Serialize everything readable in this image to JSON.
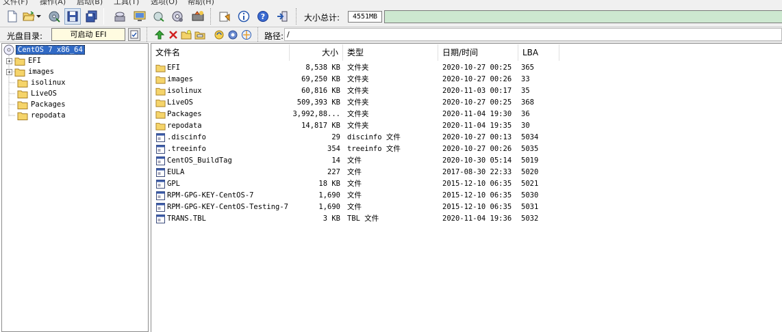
{
  "menubar": {
    "items": [
      "文件(F)",
      "操作(A)",
      "启动(B)",
      "工具(T)",
      "选项(O)",
      "帮助(H)"
    ]
  },
  "toolbar": {
    "buttons": [
      "new-icon",
      "open-icon",
      "dropdown-icon",
      "extract-icon",
      "save-icon",
      "saveas-icon",
      "burn-icon",
      "mount-icon",
      "compress-icon",
      "properties-icon",
      "virtual-drive-icon",
      "settings-icon",
      "info-icon",
      "help-icon",
      "exit-icon"
    ],
    "size_label": "大小总计:",
    "size_value": "4551MB",
    "size_bar_fill": 1.0,
    "size_bar_color": "#cde8d0"
  },
  "discbar": {
    "label": "光盘目录:",
    "boot_value": "可启动 EFI",
    "path_label": "路径:",
    "path_value": "/"
  },
  "tree": {
    "root": "CentOS 7 x86_64",
    "items": [
      {
        "label": "EFI",
        "expandable": true
      },
      {
        "label": "images",
        "expandable": true
      },
      {
        "label": "isolinux",
        "expandable": false
      },
      {
        "label": "LiveOS",
        "expandable": false
      },
      {
        "label": "Packages",
        "expandable": false
      },
      {
        "label": "repodata",
        "expandable": false
      }
    ]
  },
  "filelist": {
    "headers": {
      "name": "文件名",
      "size": "大小",
      "type": "类型",
      "date": "日期/时间",
      "lba": "LBA"
    },
    "rows": [
      {
        "name": "EFI",
        "size": "8,538 KB",
        "type": "文件夹",
        "date": "2020-10-27 00:25",
        "lba": "365",
        "icon": "folder"
      },
      {
        "name": "images",
        "size": "69,250 KB",
        "type": "文件夹",
        "date": "2020-10-27 00:26",
        "lba": "33",
        "icon": "folder"
      },
      {
        "name": "isolinux",
        "size": "60,816 KB",
        "type": "文件夹",
        "date": "2020-11-03 00:17",
        "lba": "35",
        "icon": "folder"
      },
      {
        "name": "LiveOS",
        "size": "509,393 KB",
        "type": "文件夹",
        "date": "2020-10-27 00:25",
        "lba": "368",
        "icon": "folder"
      },
      {
        "name": "Packages",
        "size": "3,992,88...",
        "type": "文件夹",
        "date": "2020-11-04 19:30",
        "lba": "36",
        "icon": "folder"
      },
      {
        "name": "repodata",
        "size": "14,817 KB",
        "type": "文件夹",
        "date": "2020-11-04 19:35",
        "lba": "30",
        "icon": "folder"
      },
      {
        "name": ".discinfo",
        "size": "29",
        "type": "discinfo 文件",
        "date": "2020-10-27 00:13",
        "lba": "5034",
        "icon": "file"
      },
      {
        "name": ".treeinfo",
        "size": "354",
        "type": "treeinfo 文件",
        "date": "2020-10-27 00:26",
        "lba": "5035",
        "icon": "file"
      },
      {
        "name": "CentOS_BuildTag",
        "size": "14",
        "type": "文件",
        "date": "2020-10-30 05:14",
        "lba": "5019",
        "icon": "file"
      },
      {
        "name": "EULA",
        "size": "227",
        "type": "文件",
        "date": "2017-08-30 22:33",
        "lba": "5020",
        "icon": "file"
      },
      {
        "name": "GPL",
        "size": "18 KB",
        "type": "文件",
        "date": "2015-12-10 06:35",
        "lba": "5021",
        "icon": "file"
      },
      {
        "name": "RPM-GPG-KEY-CentOS-7",
        "size": "1,690",
        "type": "文件",
        "date": "2015-12-10 06:35",
        "lba": "5030",
        "icon": "file"
      },
      {
        "name": "RPM-GPG-KEY-CentOS-Testing-7",
        "size": "1,690",
        "type": "文件",
        "date": "2015-12-10 06:35",
        "lba": "5031",
        "icon": "file"
      },
      {
        "name": "TRANS.TBL",
        "size": "3 KB",
        "type": "TBL 文件",
        "date": "2020-11-04 19:36",
        "lba": "5032",
        "icon": "file"
      }
    ]
  }
}
